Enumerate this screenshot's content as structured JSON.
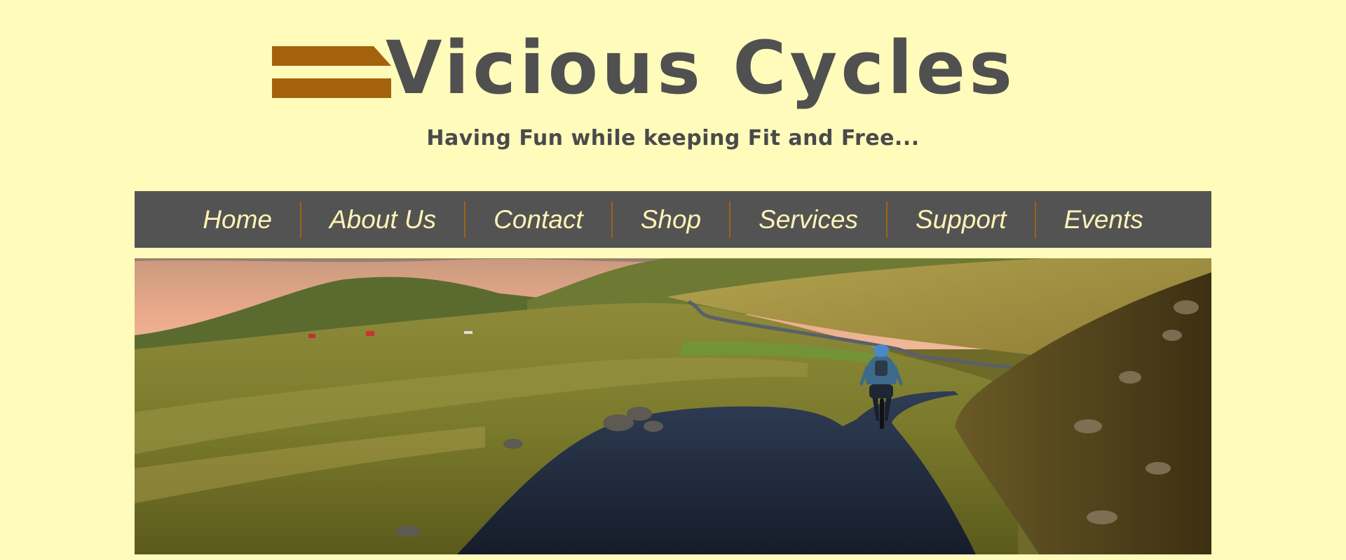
{
  "site": {
    "logo_text": "Vicious Cycles",
    "tagline": "Having Fun while keeping Fit and Free..."
  },
  "nav": {
    "items": [
      {
        "label": "Home"
      },
      {
        "label": "About Us"
      },
      {
        "label": "Contact"
      },
      {
        "label": "Shop"
      },
      {
        "label": "Services"
      },
      {
        "label": "Support"
      },
      {
        "label": "Events"
      }
    ]
  },
  "colors": {
    "background": "#FFFBBB",
    "logo_bars": "#A5620E",
    "logo_text": "#505050",
    "nav_bg": "#535353",
    "nav_text": "#FFF3B5",
    "nav_separator": "#9B6414"
  },
  "hero": {
    "icon": "cyclist-landscape-image"
  }
}
